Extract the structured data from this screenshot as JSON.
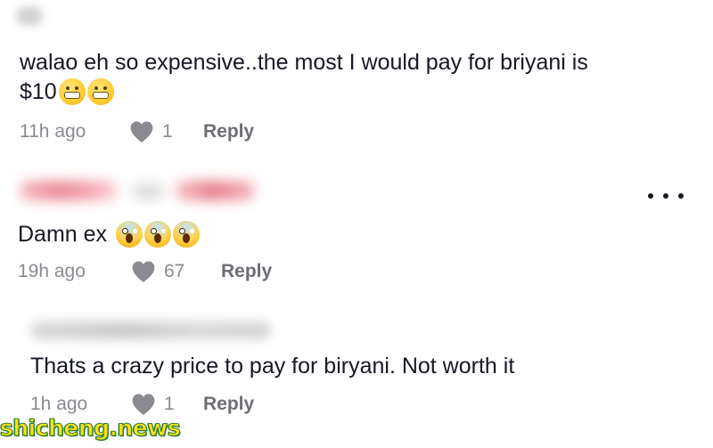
{
  "comments": [
    {
      "text_line1": "walao eh so expensive..the most I would pay for briyani is",
      "text_line2": "$10",
      "emojis": [
        "grimacing-face-icon",
        "grimacing-face-icon"
      ],
      "time": "11h ago",
      "likes": "1",
      "reply_label": "Reply"
    },
    {
      "text": "Damn ex",
      "emojis": [
        "screaming-face-icon",
        "screaming-face-icon",
        "screaming-face-icon"
      ],
      "time": "19h ago",
      "likes": "67",
      "reply_label": "Reply"
    },
    {
      "text": "Thats a crazy price to pay for biryani. Not worth it",
      "time": "1h ago",
      "likes": "1",
      "reply_label": "Reply"
    }
  ],
  "more_menu_icon": "more-horizontal-icon",
  "watermark": "shicheng.news",
  "colors": {
    "text": "#161823",
    "meta": "#8a8b91",
    "reply": "#6d6e75",
    "heart": "#8a8b91",
    "watermark_fill": "#f6e21a",
    "watermark_stroke": "#2e7d2e"
  }
}
